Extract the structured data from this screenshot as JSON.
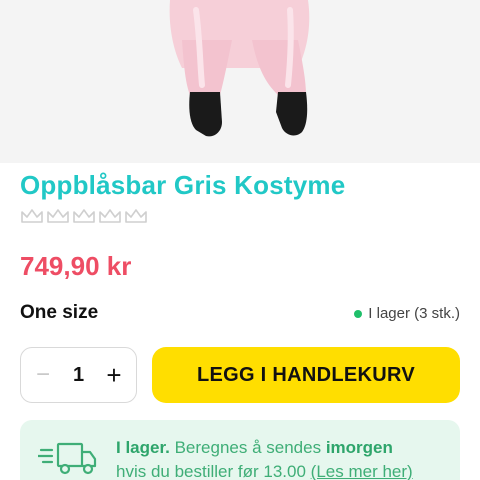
{
  "product": {
    "title": "Oppblåsbar Gris Kostyme",
    "rating_stars": 5,
    "rating_filled": 0,
    "price": "749,90 kr",
    "size": "One size",
    "stock": "I lager (3 stk.)"
  },
  "cart": {
    "quantity": "1",
    "minus_label": "−",
    "plus_label": "+",
    "add_label": "LEGG I HANDLEKURV"
  },
  "delivery": {
    "status": "I lager.",
    "text_a": " Beregnes å sendes ",
    "day": "imorgen",
    "text_b": "hvis du bestiller før 13.00 ",
    "link": "(Les mer her)"
  },
  "colors": {
    "title": "#21c8c6",
    "price": "#ee4d64",
    "button": "#ffde00",
    "stock_dot": "#1fbf6a",
    "delivery_bg": "#e6f7ee"
  }
}
